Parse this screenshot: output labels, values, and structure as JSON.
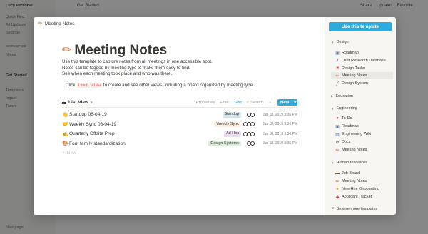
{
  "background": {
    "workspace": "Lucy Personal",
    "page_title": "Get Started",
    "top_actions": [
      "Share",
      "Updates",
      "Favorite"
    ],
    "sidebar_items": [
      "Quick Find",
      "All Updates",
      "Settings",
      "WORKSPACE",
      "Notes",
      "Get Started",
      "Templates",
      "Import",
      "Trash",
      "New page"
    ]
  },
  "modal": {
    "breadcrumb": "Meeting Notes",
    "title": "Meeting Notes",
    "description": [
      "Use this template to capture notes from all meetings in one accessible spot.",
      "Notes can be tagged by meeting type to make them easy to find.",
      "See when each meeting took place and who was there."
    ],
    "hint_prefix": "↓ Click",
    "hint_code": "List View",
    "hint_suffix": "to create and see other views, including a board organized by meeting type.",
    "toolbar": {
      "view": "List View",
      "properties": "Properties",
      "filter": "Filter",
      "sort": "Sort",
      "search": "Search",
      "more": "···",
      "new": "New"
    },
    "rows": [
      {
        "icon": "👋",
        "title": "Standup 06-04-19",
        "tag": "Standup",
        "tag_bg": "#d3e5ef",
        "date": "Jun 18, 2019 3:36 PM"
      },
      {
        "icon": "🤝",
        "title": "Weekly Sync 06-04-19",
        "tag": "Weekly Sync",
        "tag_bg": "#fbecdd",
        "date": "Jun 18, 2019 3:36 PM"
      },
      {
        "icon": "✍️",
        "title": "Quarterly Offsite Prep",
        "tag": "Ad Hoc",
        "tag_bg": "#e8deee",
        "date": "Jun 18, 2019 3:36 PM"
      },
      {
        "icon": "🎨",
        "title": "Font family standardization",
        "tag": "Design Systems",
        "tag_bg": "#dbeddb",
        "date": "Jun 18, 2019 3:36 PM"
      }
    ],
    "new_row": "New"
  },
  "templates": {
    "use_button": "Use this template",
    "sections": [
      {
        "name": "Design",
        "items": [
          "Roadmap",
          "User Research Database",
          "Design Tasks",
          "Meeting Notes",
          "Design System"
        ]
      },
      {
        "name": "Education",
        "items": []
      },
      {
        "name": "Engineering",
        "items": [
          "To-Do",
          "Roadmap",
          "Engineering Wiki",
          "Docs",
          "Meeting Notes"
        ]
      },
      {
        "name": "Human resources",
        "items": [
          "Job Board",
          "Meeting Notes",
          "New Hire Onboarding",
          "Applicant Tracker"
        ]
      }
    ],
    "browse": "Browse more templates",
    "colors": {
      "accent": "#2eaadc"
    }
  }
}
